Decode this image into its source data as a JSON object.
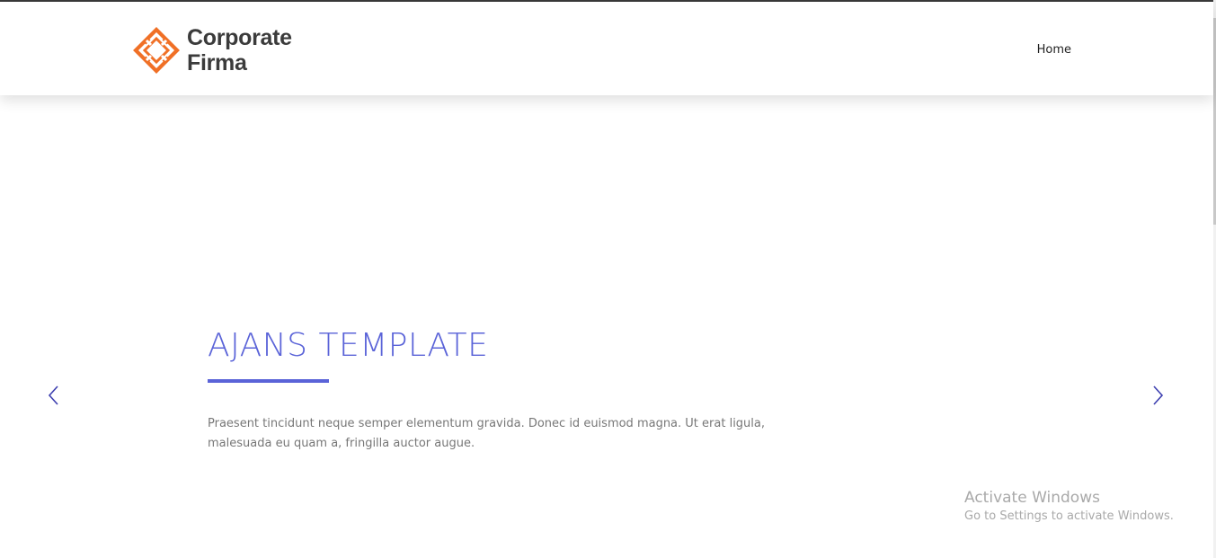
{
  "brand": {
    "line1": "Corporate",
    "line2": "Firma",
    "logo_icon": "diamond-logo-icon",
    "logo_color": "#f07026"
  },
  "nav": {
    "items": [
      {
        "label": "Home"
      }
    ]
  },
  "hero": {
    "title": "AJANS TEMPLATE",
    "text": "Praesent tincidunt neque semper elementum gravida. Donec id euismod magna. Ut erat ligula, malesuada eu quam a, fringilla auctor augue.",
    "accent_color": "#5a63d8",
    "prev_icon": "chevron-left-icon",
    "next_icon": "chevron-right-icon"
  },
  "os_watermark": {
    "title": "Activate Windows",
    "subtitle": "Go to Settings to activate Windows."
  }
}
